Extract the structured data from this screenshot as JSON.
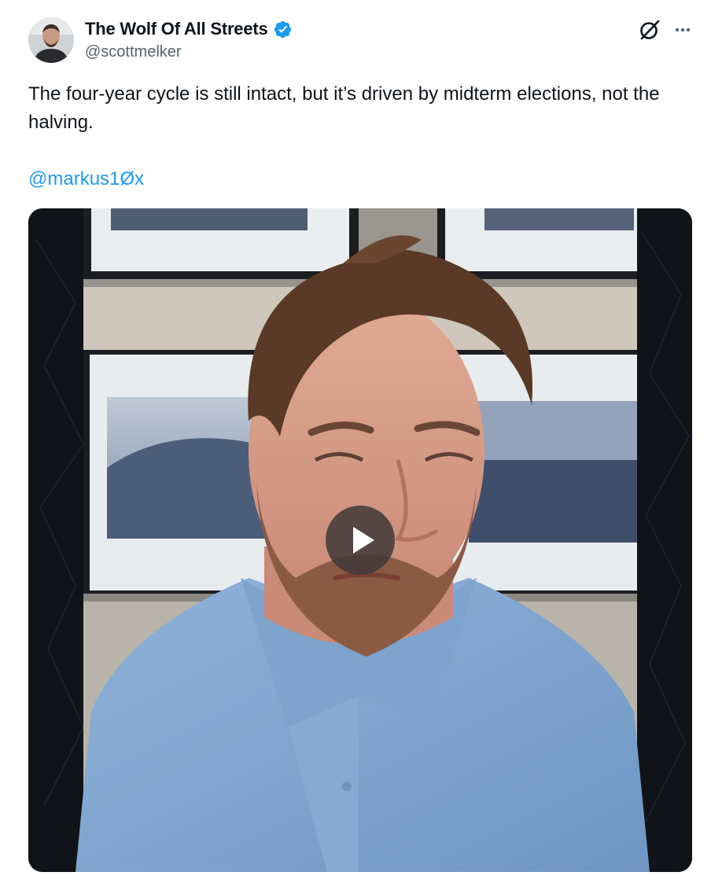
{
  "tweet": {
    "author": {
      "display_name": "The Wolf Of All Streets",
      "handle": "@scottmelker",
      "verified": true
    },
    "text": "The four-year cycle is still intact, but it’s driven by midterm elections, not the halving.",
    "mention": "@markus1Øx",
    "media": {
      "type": "video",
      "play_icon": "play-icon"
    }
  },
  "icons": {
    "grok": "grok-icon",
    "more": "more-options-icon",
    "verified": "verified-badge-icon"
  },
  "colors": {
    "text": "#0f1419",
    "secondary_text": "#536471",
    "link": "#1d9bf0",
    "verified": "#1d9bf0"
  }
}
